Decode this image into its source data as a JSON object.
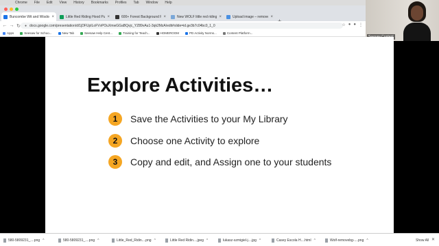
{
  "menubar": [
    "Chrome",
    "File",
    "Edit",
    "View",
    "History",
    "Bookmarks",
    "Profiles",
    "Tab",
    "Window",
    "Help"
  ],
  "tabs": [
    {
      "label": "Buncombe Wit and Wisdom - ",
      "color": "#1a73e8",
      "active": true
    },
    {
      "label": "Little Red Riding Hood Puppe",
      "color": "#0f9d58"
    },
    {
      "label": "600+ Forest Background Pictu",
      "color": "#333333"
    },
    {
      "label": "New WOLF little red riding hoo",
      "color": "#7aa7d8"
    },
    {
      "label": "Upload image – remove.bg",
      "color": "#4a90e2"
    }
  ],
  "address": {
    "url": "docs.google.com/presentation/d/1jDFUpILoFVvPOuXmwGGaBQvjc_YZ89vAu1-3qk2MzA/edit#slide=id.ge3b7c04bc0_1_0"
  },
  "bookmarks": [
    {
      "label": "Apps",
      "color": "#4285f4"
    },
    {
      "label": "Seesaw for Schoo...",
      "color": "#34a853"
    },
    {
      "label": "New Tab",
      "color": "#1a73e8"
    },
    {
      "label": "Seesaw Help Cent...",
      "color": "#34a853"
    },
    {
      "label": "Training for Teach...",
      "color": "#34a853"
    },
    {
      "label": "HOMEROOM",
      "color": "#333333"
    },
    {
      "label": "PD Activity Norms...",
      "color": "#1a73e8"
    },
    {
      "label": "Content Platform...",
      "color": "#777777"
    }
  ],
  "webcam": {
    "name": "Seesaw Content"
  },
  "slide": {
    "title": "Explore Activities…",
    "steps": [
      {
        "num": "1",
        "text": "Save the Activities to your My Library"
      },
      {
        "num": "2",
        "text": "Choose one Activity to explore"
      },
      {
        "num": "3",
        "text": "Copy and edit, and Assign one to your students"
      }
    ],
    "accent": "#f5a623"
  },
  "downloads": [
    {
      "label": "580-5809231_....png"
    },
    {
      "label": "580-5809231_....png"
    },
    {
      "label": "Little_Red_Ridin....png"
    },
    {
      "label": "Little Red Ridin....jpeg"
    },
    {
      "label": "lukasz-szmigiel-j....jpg"
    },
    {
      "label": "Casey Escola H....html"
    },
    {
      "label": "Wolf-removebg-....png"
    }
  ],
  "shelf": {
    "show_all": "Show All",
    "close": "✕"
  },
  "icons": {
    "back": "←",
    "forward": "→",
    "reload": "↻",
    "lock": "🔒",
    "star": "☆",
    "new_tab": "+",
    "tab_close": "×",
    "caret": "^"
  }
}
